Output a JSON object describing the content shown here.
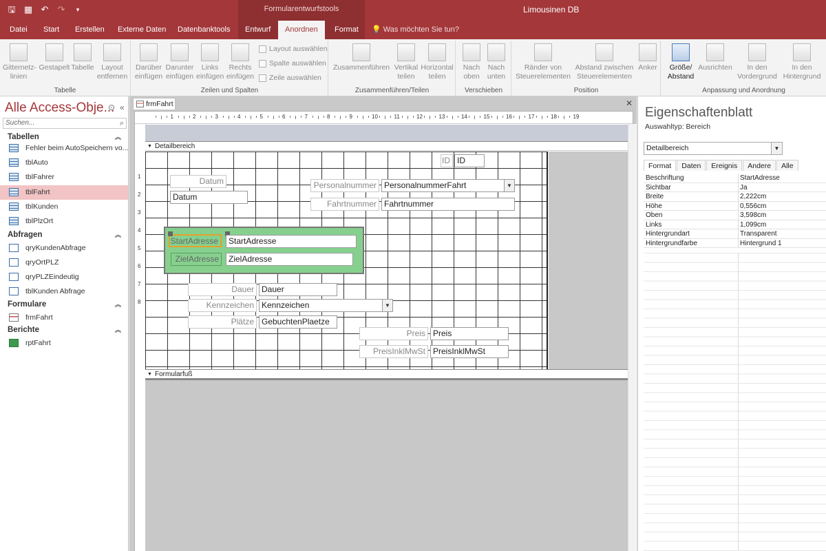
{
  "titlebar": {
    "context_group": "Formularentwurfstools",
    "app_title": "Limousinen DB"
  },
  "tabs": [
    "Datei",
    "Start",
    "Erstellen",
    "Externe Daten",
    "Datenbanktools",
    "Entwurf",
    "Anordnen",
    "Format"
  ],
  "active_tab": "Anordnen",
  "tell_me": "Was möchten Sie tun?",
  "ribbon": {
    "groups": [
      {
        "label": "Tabelle",
        "buttons": [
          "Gitternetz-\nlinien",
          "Gestapelt",
          "Tabelle",
          "Layout\nentfernen"
        ]
      },
      {
        "label": "Zeilen und Spalten",
        "buttons": [
          "Darüber\neinfügen",
          "Darunter\neinfügen",
          "Links\neinfügen",
          "Rechts\neinfügen"
        ],
        "small": [
          "Layout auswählen",
          "Spalte auswählen",
          "Zeile auswählen"
        ]
      },
      {
        "label": "Zusammenführen/Teilen",
        "buttons": [
          "Zusammenführen",
          "Vertikal\nteilen",
          "Horizontal\nteilen"
        ]
      },
      {
        "label": "Verschieben",
        "buttons": [
          "Nach\noben",
          "Nach\nunten"
        ]
      },
      {
        "label": "Position",
        "buttons": [
          "Ränder von\nSteuerelementen",
          "Abstand zwischen\nSteuerelementen",
          "Anker"
        ]
      },
      {
        "label": "Anpassung und Anordnung",
        "buttons": [
          "Größe/\nAbstand",
          "Ausrichten",
          "In den\nVordergrund",
          "In den\nHintergrund"
        ]
      }
    ]
  },
  "nav": {
    "title": "Alle Access-Obje...",
    "search_placeholder": "Suchen...",
    "sections": [
      {
        "name": "Tabellen",
        "items": [
          "Fehler beim AutoSpeichern vo...",
          "tblAuto",
          "tblFahrer",
          "tblFahrt",
          "tblKunden",
          "tblPlzOrt"
        ]
      },
      {
        "name": "Abfragen",
        "items": [
          "qryKundenAbfrage",
          "qryOrtPLZ",
          "qryPLZEindeutig",
          "tblKunden Abfrage"
        ]
      },
      {
        "name": "Formulare",
        "items": [
          "frmFahrt"
        ]
      },
      {
        "name": "Berichte",
        "items": [
          "rptFahrt"
        ]
      }
    ],
    "selected": "tblFahrt"
  },
  "document": {
    "tab": "frmFahrt",
    "detail_section": "Detailbereich",
    "footer_section": "Formularfuß",
    "ruler_h": [
      "1",
      "2",
      "3",
      "4",
      "5",
      "6",
      "7",
      "8",
      "9",
      "10",
      "11",
      "12",
      "13",
      "14",
      "15",
      "16",
      "17",
      "18",
      "19"
    ],
    "ruler_v": [
      "1",
      "2",
      "3",
      "4",
      "5",
      "6",
      "7",
      "8"
    ],
    "labels": {
      "id": "ID",
      "datum": "Datum",
      "personalnummer": "Personalnummer",
      "fahrtnummer": "Fahrtnummer",
      "startadresse": "StartAdresse",
      "zieladresse": "ZielAdresse",
      "dauer": "Dauer",
      "kennzeichen": "Kennzeichen",
      "plaetze": "Plätze",
      "preis": "Preis",
      "preisinklmwst": "PreisInklMwSt"
    },
    "fields": {
      "id": "ID",
      "datum": "Datum",
      "personalnummer": "PersonalnummerFahrt",
      "fahrtnummer": "Fahrtnummer",
      "startadresse": "StartAdresse",
      "zieladresse": "ZielAdresse",
      "dauer": "Dauer",
      "kennzeichen": "Kennzeichen",
      "plaetze": "GebuchtenPlaetze",
      "preis": "Preis",
      "preisinklmwst": "PreisInklMwSt"
    }
  },
  "property_sheet": {
    "title": "Eigenschaftenblatt",
    "selection_type_label": "Auswahltyp:",
    "selection_type_value": "Bereich",
    "dropdown_value": "Detailbereich",
    "tabs": [
      "Format",
      "Daten",
      "Ereignis",
      "Andere",
      "Alle"
    ],
    "active_tab": "Format",
    "rows": [
      {
        "key": "Beschriftung",
        "value": "StartAdresse"
      },
      {
        "key": "Sichtbar",
        "value": "Ja"
      },
      {
        "key": "Breite",
        "value": "2,222cm"
      },
      {
        "key": "Höhe",
        "value": "0,556cm"
      },
      {
        "key": "Oben",
        "value": "3,598cm"
      },
      {
        "key": "Links",
        "value": "1,099cm"
      },
      {
        "key": "Hintergrundart",
        "value": "Transparent"
      },
      {
        "key": "Hintergrundfarbe",
        "value": "Hintergrund 1"
      }
    ]
  }
}
